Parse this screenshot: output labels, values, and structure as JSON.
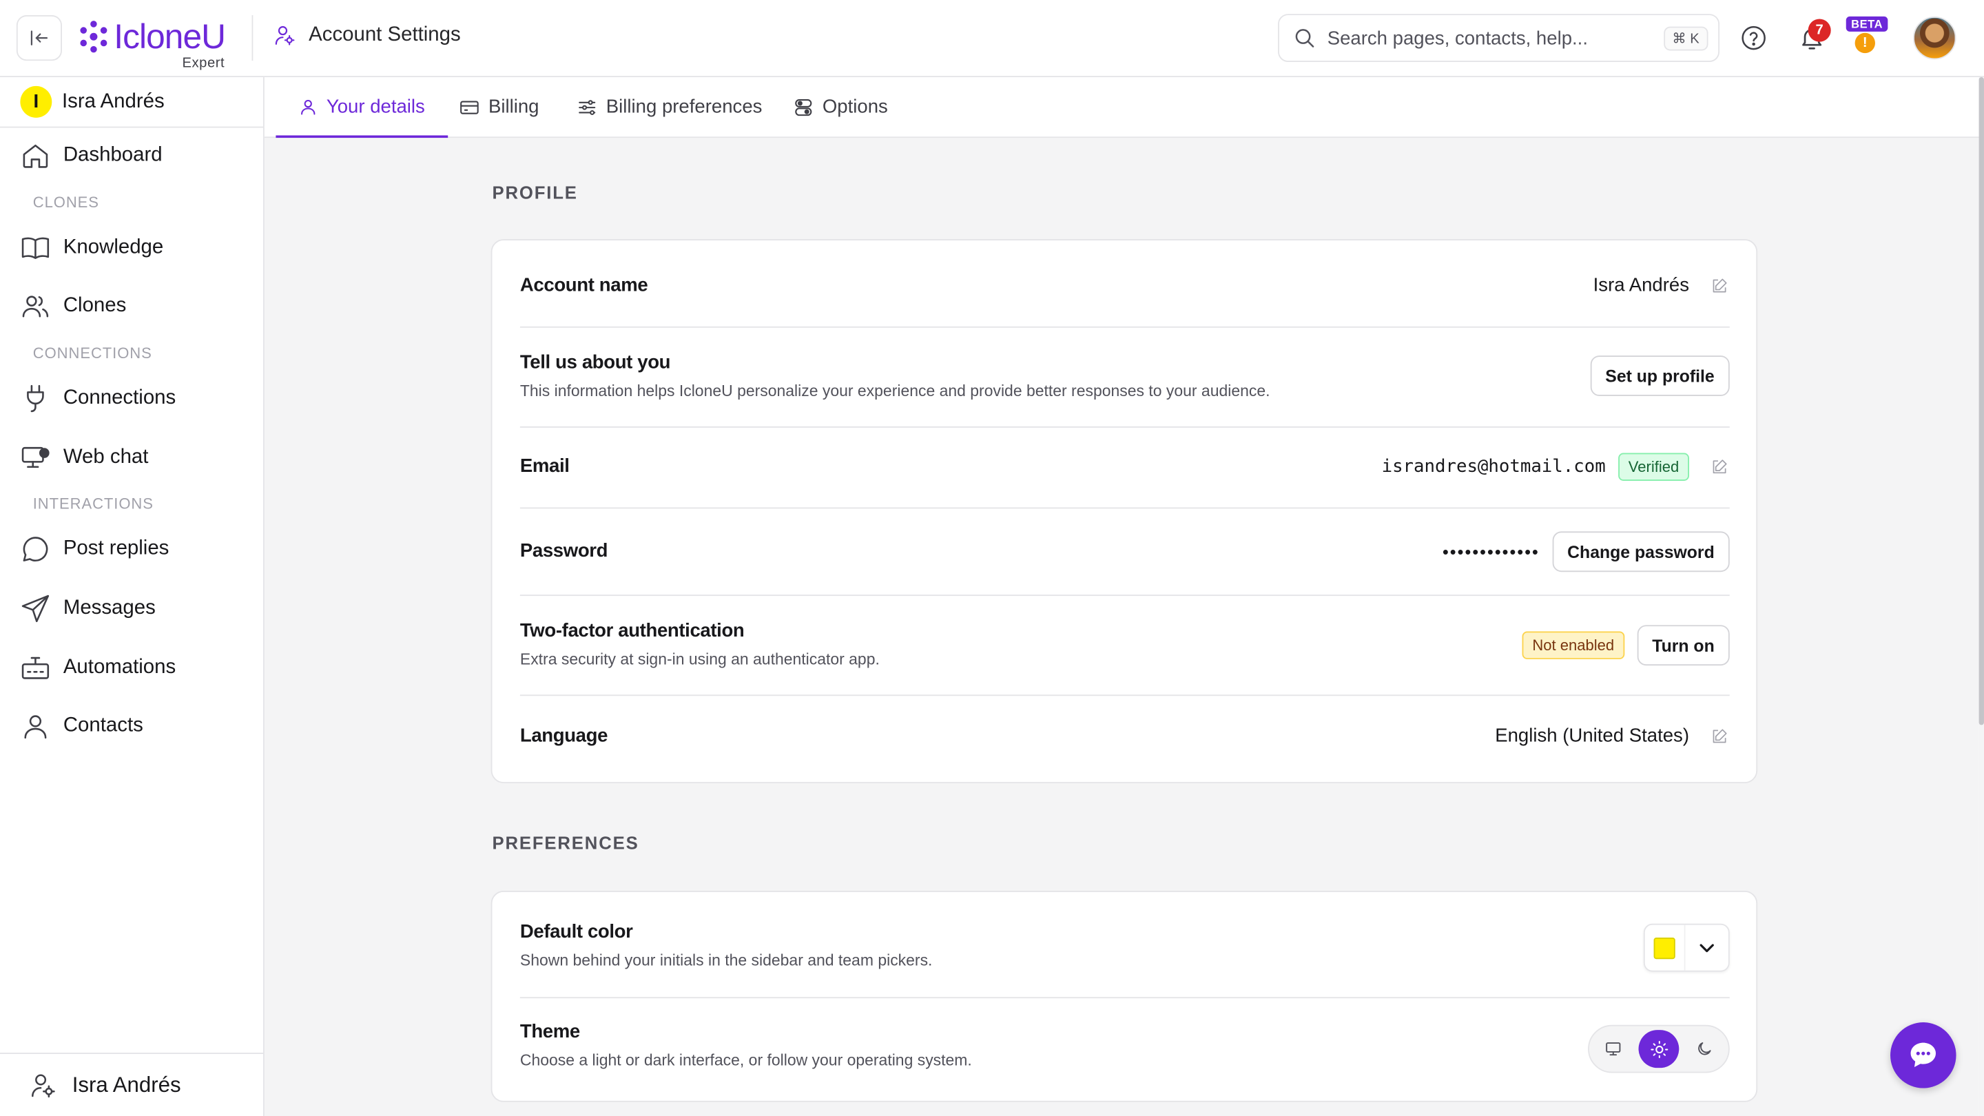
{
  "app": {
    "logo_text": "IcloneU",
    "logo_sub": "Expert",
    "page_title": "Account Settings",
    "brand_color": "#6d28d9"
  },
  "search": {
    "placeholder": "Search pages, contacts, help...",
    "shortcut": "⌘ K"
  },
  "topbar": {
    "notification_count": "7",
    "beta_label": "BETA",
    "warning_glyph": "!"
  },
  "sidebar": {
    "user_initial": "I",
    "user_name": "Isra Andrés",
    "initial_color": "#ffee00",
    "dashboard": "Dashboard",
    "sections": {
      "clones": "CLONES",
      "connections": "CONNECTIONS",
      "interactions": "INTERACTIONS"
    },
    "items": {
      "knowledge": "Knowledge",
      "clones": "Clones",
      "connections": "Connections",
      "web_chat": "Web chat",
      "post_replies": "Post replies",
      "messages": "Messages",
      "automations": "Automations",
      "contacts": "Contacts"
    },
    "footer_name": "Isra Andrés"
  },
  "tabs": {
    "your_details": "Your details",
    "billing": "Billing",
    "billing_preferences": "Billing preferences",
    "options": "Options",
    "active": "your_details"
  },
  "profile": {
    "title": "PROFILE",
    "account_name": {
      "label": "Account name",
      "value": "Isra Andrés"
    },
    "about": {
      "label": "Tell us about you",
      "desc": "This information helps IcloneU personalize your experience and provide better responses to your audience.",
      "button": "Set up profile"
    },
    "email": {
      "label": "Email",
      "value": "israndres@hotmail.com",
      "badge": "Verified"
    },
    "password": {
      "label": "Password",
      "value": "•••••••••••••",
      "button": "Change password"
    },
    "two_factor": {
      "label": "Two-factor authentication",
      "desc": "Extra security at sign-in using an authenticator app.",
      "badge": "Not enabled",
      "button": "Turn on"
    },
    "language": {
      "label": "Language",
      "value": "English (United States)"
    }
  },
  "preferences": {
    "title": "PREFERENCES",
    "default_color": {
      "label": "Default color",
      "desc": "Shown behind your initials in the sidebar and team pickers.",
      "value": "#ffee00"
    },
    "theme": {
      "label": "Theme",
      "desc": "Choose a light or dark interface, or follow your operating system.",
      "options": [
        "system",
        "light",
        "dark"
      ],
      "selected": "light"
    }
  }
}
